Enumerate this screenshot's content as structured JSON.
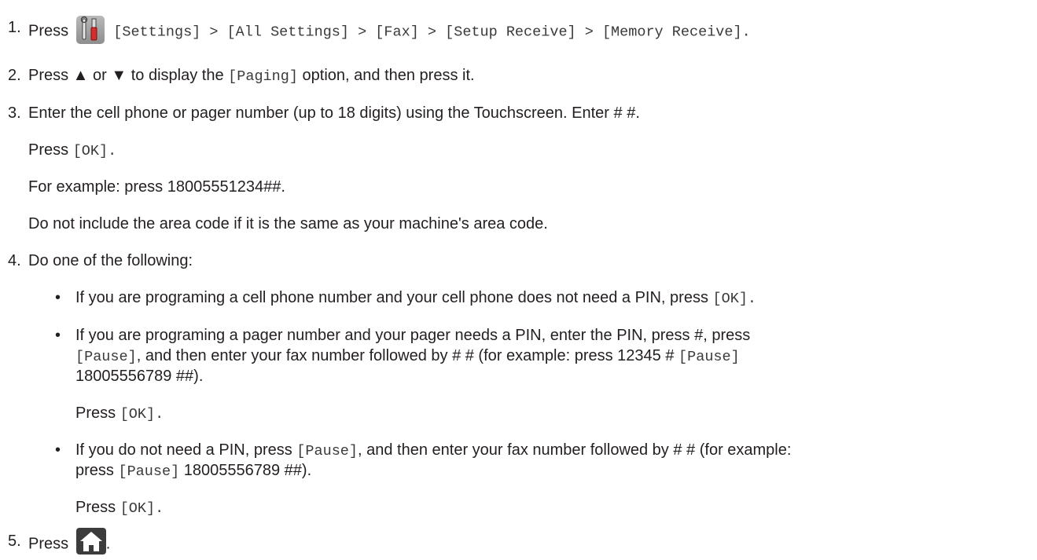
{
  "steps": [
    {
      "number": "1.",
      "press": "Press",
      "path": "[Settings] > [All Settings] > [Fax] > [Setup Receive] > [Memory Receive].",
      "icon": "settings-tools-icon"
    },
    {
      "number": "2.",
      "before": "Press ▲ or ▼ to display the",
      "option": "[Paging]",
      "after": "option, and then press it."
    },
    {
      "number": "3.",
      "text": "Enter the cell phone or pager number (up to 18 digits) using the Touchscreen. Enter # #.",
      "press_label": "Press",
      "ok": "[OK].",
      "example": "For example: press 18005551234##.",
      "note": "Do not include the area code if it is the same as your machine's area code."
    },
    {
      "number": "4.",
      "text": "Do one of the following:",
      "bullets": [
        {
          "before": "If you are programing a cell phone number and your cell phone does not need a PIN, press",
          "ok": "[OK]."
        },
        {
          "line1": "If you are programing a pager number and your pager needs a PIN, enter the PIN, press #, press",
          "pause1": "[Pause]",
          "mid": ", and then enter your fax number followed by # # (for example: press 12345 #",
          "pause2": "[Pause]",
          "line3": "18005556789 ##).",
          "press_label": "Press",
          "ok": "[OK]."
        },
        {
          "before": "If you do not need a PIN, press",
          "pause1": "[Pause]",
          "after": ", and then enter your fax number followed by # # (for example:",
          "press_word": "press",
          "pause2": "[Pause]",
          "tail": "18005556789 ##).",
          "press_label": "Press",
          "ok": "[OK]."
        }
      ]
    },
    {
      "number": "5.",
      "press": "Press",
      "icon": "home-icon",
      "period": "."
    }
  ],
  "colors": {
    "text": "#231f20",
    "mono": "#3a3a3a",
    "icon_gray": "#a0a0a0",
    "icon_dark": "#3c3c3c"
  }
}
